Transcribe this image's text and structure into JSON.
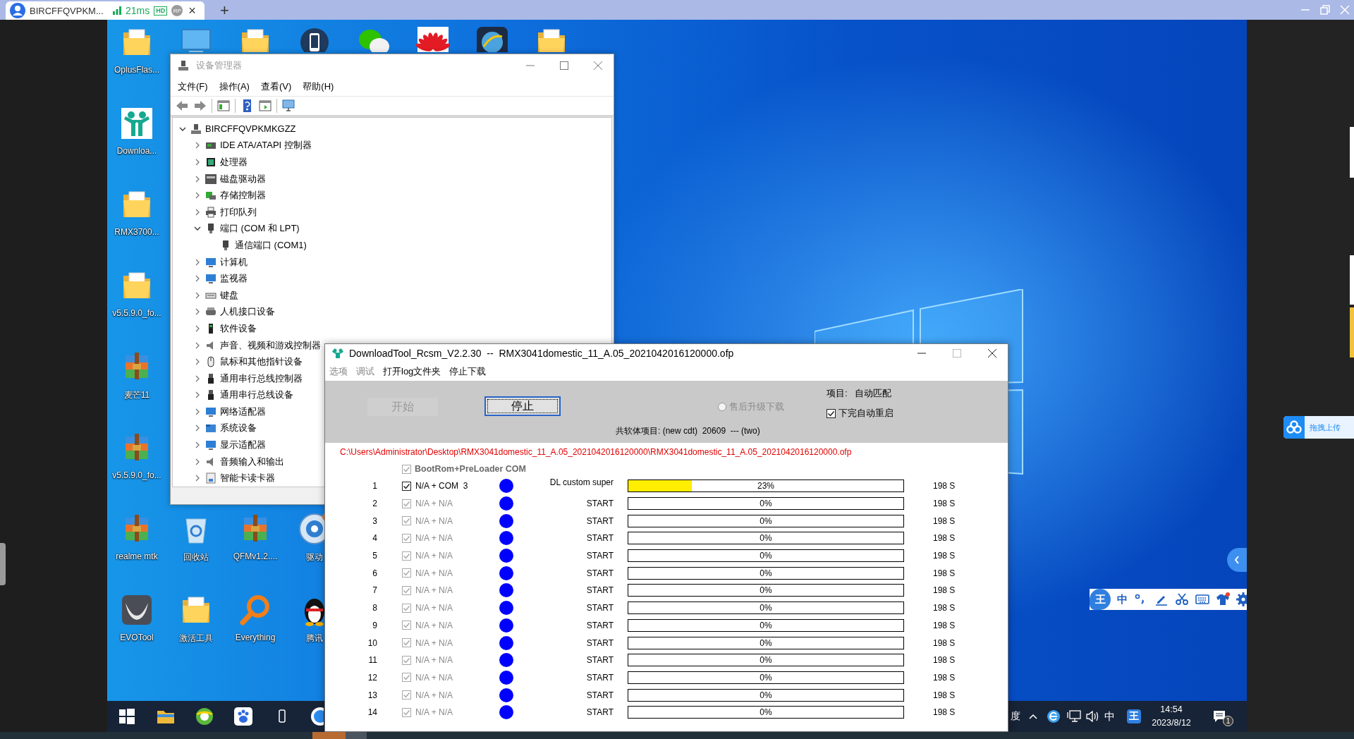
{
  "remote_tab": {
    "title": "BIRCFFQVPKM...",
    "latency": "21ms",
    "quality": "HD",
    "badge": "RP",
    "close": "×"
  },
  "new_tab": "+",
  "desktop_icons": [
    {
      "label": "OplusFlas...",
      "kind": "folder"
    },
    {
      "kind": "computer"
    },
    {
      "kind": "folder"
    },
    {
      "kind": "phone"
    },
    {
      "kind": "chat"
    },
    {
      "kind": "flower"
    },
    {
      "kind": "globe"
    },
    {
      "kind": "folder"
    },
    {
      "label": "Downloa...",
      "kind": "app"
    },
    {
      "label": "RMX3700...",
      "kind": "folder"
    },
    {
      "label": "v5.5.9.0_fo...",
      "kind": "folder"
    },
    {
      "label": "麦芒11",
      "kind": "archive"
    },
    {
      "label": "v5.5.9.0_fo...",
      "kind": "archive"
    },
    {
      "label": "realme mtk",
      "kind": "archive"
    },
    {
      "label": "回收站",
      "kind": "recycle"
    },
    {
      "label": "QFMv1.2....",
      "kind": "archive"
    },
    {
      "label": "驱动",
      "kind": "gear"
    },
    {
      "label": "EVOTool",
      "kind": "evo"
    },
    {
      "label": "激活工具",
      "kind": "folder"
    },
    {
      "label": "Everything",
      "kind": "search"
    },
    {
      "label": "腾讯",
      "kind": "penguin"
    }
  ],
  "device_manager": {
    "title": "设备管理器",
    "active": false,
    "menu": [
      "文件(F)",
      "操作(A)",
      "查看(V)",
      "帮助(H)"
    ],
    "tree": {
      "label": "BIRCFFQVPKMKGZZ",
      "kind": "computer",
      "expanded": true,
      "children": [
        {
          "label": "IDE ATA/ATAPI 控制器",
          "kind": "ide",
          "expanded": false
        },
        {
          "label": "处理器",
          "kind": "cpu",
          "expanded": false
        },
        {
          "label": "磁盘驱动器",
          "kind": "disk",
          "expanded": false
        },
        {
          "label": "存储控制器",
          "kind": "storage",
          "expanded": false
        },
        {
          "label": "打印队列",
          "kind": "printer",
          "expanded": false
        },
        {
          "label": "端口 (COM 和 LPT)",
          "kind": "port",
          "expanded": true,
          "children": [
            {
              "label": "通信端口 (COM1)",
              "kind": "port"
            }
          ]
        },
        {
          "label": "计算机",
          "kind": "monitor",
          "expanded": false
        },
        {
          "label": "监视器",
          "kind": "monitor",
          "expanded": false
        },
        {
          "label": "键盘",
          "kind": "keyboard",
          "expanded": false
        },
        {
          "label": "人机接口设备",
          "kind": "hid",
          "expanded": false
        },
        {
          "label": "软件设备",
          "kind": "software",
          "expanded": false
        },
        {
          "label": "声音、视频和游戏控制器",
          "kind": "sound",
          "expanded": false
        },
        {
          "label": "鼠标和其他指针设备",
          "kind": "mouse",
          "expanded": false
        },
        {
          "label": "通用串行总线控制器",
          "kind": "usb",
          "expanded": false
        },
        {
          "label": "通用串行总线设备",
          "kind": "usb",
          "expanded": false
        },
        {
          "label": "网络适配器",
          "kind": "monitor",
          "expanded": false
        },
        {
          "label": "系统设备",
          "kind": "system",
          "expanded": false
        },
        {
          "label": "显示适配器",
          "kind": "monitor",
          "expanded": false
        },
        {
          "label": "音频输入和输出",
          "kind": "sound",
          "expanded": false
        },
        {
          "label": "智能卡读卡器",
          "kind": "card",
          "expanded": false
        }
      ]
    }
  },
  "download_tool": {
    "title": "DownloadTool_Rcsm_V2.2.30  --  RMX3041domestic_11_A.05_2021042016120000.ofp",
    "menu": [
      {
        "label": "选项",
        "disabled": true
      },
      {
        "label": "调试",
        "disabled": true
      },
      {
        "label": "打开log文件夹",
        "disabled": false
      },
      {
        "label": "停止下载",
        "disabled": false
      }
    ],
    "start_button": {
      "label": "开始",
      "disabled": true
    },
    "stop_button": {
      "label": "停止",
      "disabled": false,
      "focused": true
    },
    "download_mode": {
      "label": "售后升级下载",
      "selected": false,
      "disabled": true
    },
    "project_label": "项目:",
    "project_value": "自动匹配",
    "auto_reboot": {
      "label": "下完自动重启",
      "checked": true
    },
    "firmware_info": "共软体项目: (new cdt)  20609  --- (two)",
    "path": "C:\\Users\\Administrator\\Desktop\\RMX3041domestic_11_A.05_2021042016120000\\RMX3041domestic_11_A.05_2021042016120000.ofp",
    "bootrom": {
      "label": "BootRom+PreLoader COM",
      "checked": true,
      "disabled": true
    },
    "ports": [
      {
        "index": "1",
        "checked": true,
        "disabled": false,
        "port": "N/A + COM  3",
        "color": "#0000ff",
        "status": "DL custom super",
        "level": 0.23,
        "percent": "23%",
        "time": "198 S"
      },
      {
        "index": "2",
        "checked": true,
        "disabled": true,
        "port": "N/A + N/A",
        "color": "#0000ff",
        "status": "START",
        "level": 0,
        "percent": "0%",
        "time": "198 S"
      },
      {
        "index": "3",
        "checked": true,
        "disabled": true,
        "port": "N/A + N/A",
        "color": "#0000ff",
        "status": "START",
        "level": 0,
        "percent": "0%",
        "time": "198 S"
      },
      {
        "index": "4",
        "checked": true,
        "disabled": true,
        "port": "N/A + N/A",
        "color": "#0000ff",
        "status": "START",
        "level": 0,
        "percent": "0%",
        "time": "198 S"
      },
      {
        "index": "5",
        "checked": true,
        "disabled": true,
        "port": "N/A + N/A",
        "color": "#0000ff",
        "status": "START",
        "level": 0,
        "percent": "0%",
        "time": "198 S"
      },
      {
        "index": "6",
        "checked": true,
        "disabled": true,
        "port": "N/A + N/A",
        "color": "#0000ff",
        "status": "START",
        "level": 0,
        "percent": "0%",
        "time": "198 S"
      },
      {
        "index": "7",
        "checked": true,
        "disabled": true,
        "port": "N/A + N/A",
        "color": "#0000ff",
        "status": "START",
        "level": 0,
        "percent": "0%",
        "time": "198 S"
      },
      {
        "index": "8",
        "checked": true,
        "disabled": true,
        "port": "N/A + N/A",
        "color": "#0000ff",
        "status": "START",
        "level": 0,
        "percent": "0%",
        "time": "198 S"
      },
      {
        "index": "9",
        "checked": true,
        "disabled": true,
        "port": "N/A + N/A",
        "color": "#0000ff",
        "status": "START",
        "level": 0,
        "percent": "0%",
        "time": "198 S"
      },
      {
        "index": "10",
        "checked": true,
        "disabled": true,
        "port": "N/A + N/A",
        "color": "#0000ff",
        "status": "START",
        "level": 0,
        "percent": "0%",
        "time": "198 S"
      },
      {
        "index": "11",
        "checked": true,
        "disabled": true,
        "port": "N/A + N/A",
        "color": "#0000ff",
        "status": "START",
        "level": 0,
        "percent": "0%",
        "time": "198 S"
      },
      {
        "index": "12",
        "checked": true,
        "disabled": true,
        "port": "N/A + N/A",
        "color": "#0000ff",
        "status": "START",
        "level": 0,
        "percent": "0%",
        "time": "198 S"
      },
      {
        "index": "13",
        "checked": true,
        "disabled": true,
        "port": "N/A + N/A",
        "color": "#0000ff",
        "status": "START",
        "level": 0,
        "percent": "0%",
        "time": "198 S"
      },
      {
        "index": "14",
        "checked": true,
        "disabled": true,
        "port": "N/A + N/A",
        "color": "#0000ff",
        "status": "START",
        "level": 0,
        "percent": "0%",
        "time": "198 S"
      }
    ]
  },
  "taskbar": {
    "apps": [
      {
        "kind": "start"
      },
      {
        "kind": "explorer"
      },
      {
        "kind": "browser"
      },
      {
        "kind": "paw"
      },
      {
        "kind": "phone"
      },
      {
        "kind": "round"
      }
    ],
    "tray_text": "度",
    "ime_mode": "中",
    "ime_logo": "王",
    "time": "14:54",
    "date": "2023/8/12",
    "notification_count": "1"
  },
  "ime_toolbar": {
    "logo": "王",
    "mode": "中"
  },
  "side_panel": {
    "upload_button": "拖拽上传"
  }
}
